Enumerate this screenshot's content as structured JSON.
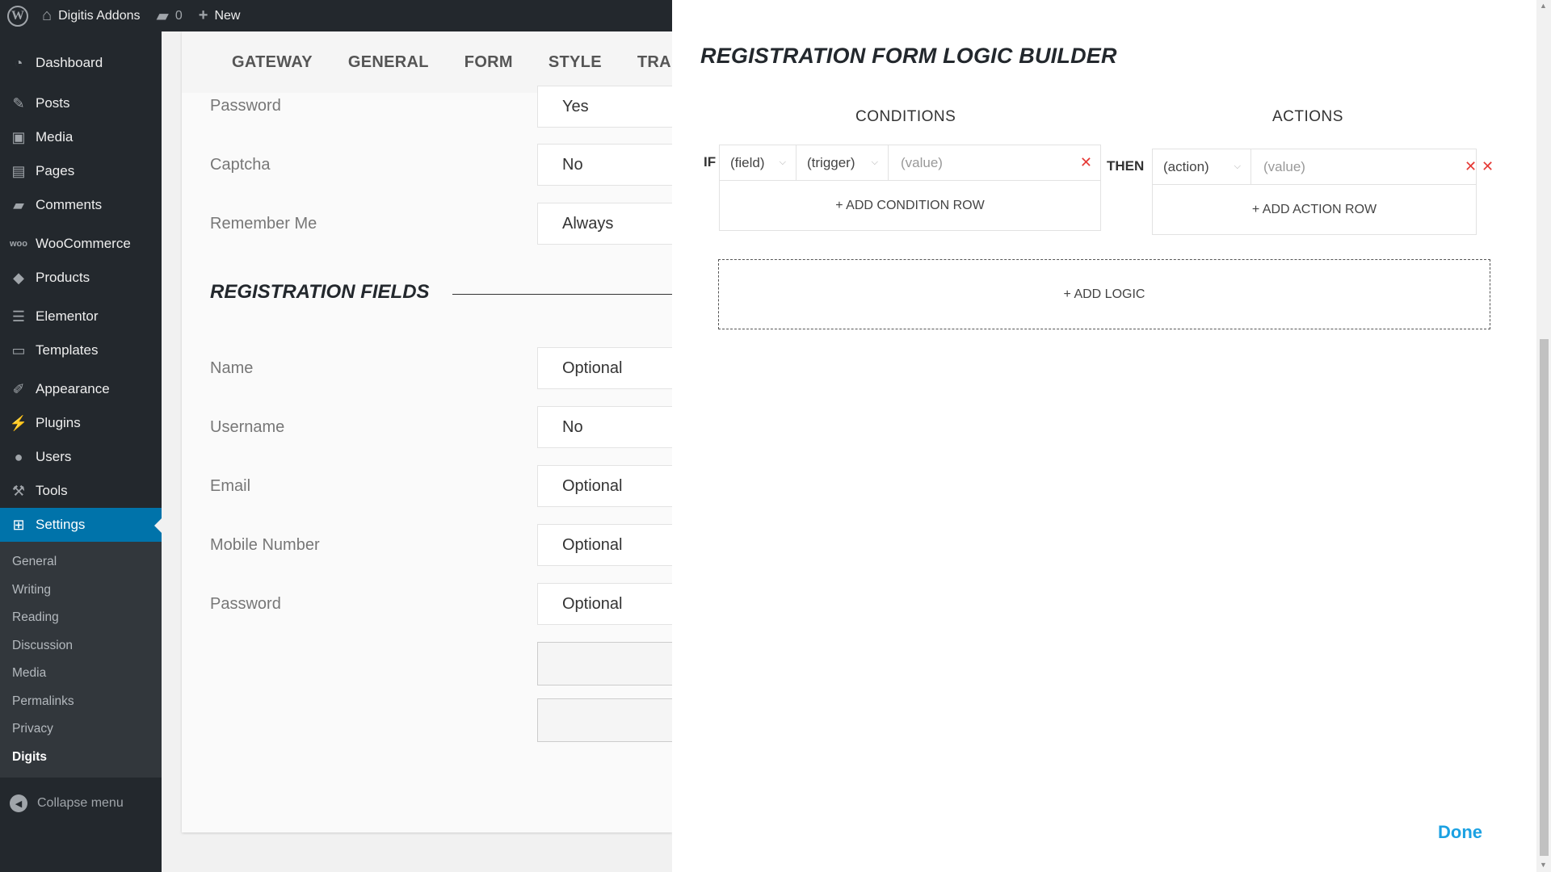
{
  "adminbar": {
    "site_name": "Digitis Addons",
    "comments_count": "0",
    "new_label": "New"
  },
  "sidebar": {
    "items": [
      {
        "label": "Dashboard",
        "icon": "dashboard-icon"
      },
      {
        "label": "Posts",
        "icon": "pin-icon"
      },
      {
        "label": "Media",
        "icon": "media-icon"
      },
      {
        "label": "Pages",
        "icon": "pages-icon"
      },
      {
        "label": "Comments",
        "icon": "comment-icon"
      },
      {
        "label": "WooCommerce",
        "icon": "woo-icon"
      },
      {
        "label": "Products",
        "icon": "box-icon"
      },
      {
        "label": "Elementor",
        "icon": "elementor-icon"
      },
      {
        "label": "Templates",
        "icon": "folder-icon"
      },
      {
        "label": "Appearance",
        "icon": "brush-icon"
      },
      {
        "label": "Plugins",
        "icon": "plug-icon"
      },
      {
        "label": "Users",
        "icon": "user-icon"
      },
      {
        "label": "Tools",
        "icon": "wrench-icon"
      },
      {
        "label": "Settings",
        "icon": "settings-icon"
      }
    ],
    "submenu": [
      "General",
      "Writing",
      "Reading",
      "Discussion",
      "Media",
      "Permalinks",
      "Privacy",
      "Digits"
    ],
    "collapse_label": "Collapse menu"
  },
  "settings_panel": {
    "tabs": [
      "GATEWAY",
      "GENERAL",
      "FORM",
      "STYLE",
      "TRANS"
    ],
    "login_rows": [
      {
        "label": "Password",
        "value": "Yes"
      },
      {
        "label": "Captcha",
        "value": "No"
      },
      {
        "label": "Remember Me",
        "value": "Always"
      }
    ],
    "registration_heading": "REGISTRATION FIELDS",
    "registration_rows": [
      {
        "label": "Name",
        "value": "Optional"
      },
      {
        "label": "Username",
        "value": "No"
      },
      {
        "label": "Email",
        "value": "Optional"
      },
      {
        "label": "Mobile Number",
        "value": "Optional"
      },
      {
        "label": "Password",
        "value": "Optional"
      }
    ]
  },
  "modal": {
    "title": "REGISTRATION FORM LOGIC BUILDER",
    "conditions_heading": "CONDITIONS",
    "actions_heading": "ACTIONS",
    "if_label": "IF",
    "then_label": "THEN",
    "condition": {
      "field": "(field)",
      "trigger": "(trigger)",
      "value_placeholder": "(value)"
    },
    "action": {
      "action": "(action)",
      "value_placeholder": "(value)"
    },
    "add_condition_row": "+ ADD CONDITION ROW",
    "add_action_row": "+ ADD ACTION ROW",
    "add_logic": "+ ADD LOGIC",
    "done_label": "Done"
  },
  "colors": {
    "adminbar_bg": "#23282d",
    "active_menu_bg": "#0073aa",
    "remove_red": "#e53935",
    "done_blue": "#1ba1e2"
  }
}
